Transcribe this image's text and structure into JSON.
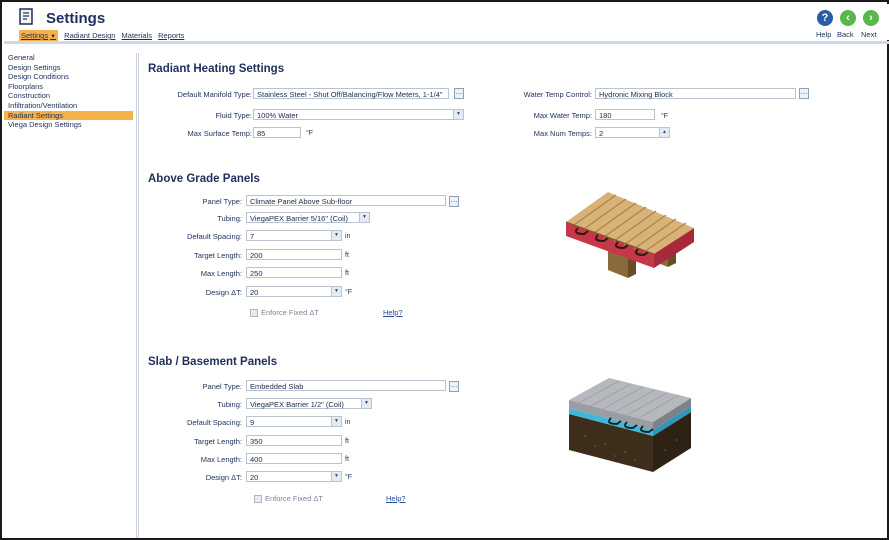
{
  "app": {
    "title": "Settings",
    "icon": "document-icon"
  },
  "nav": {
    "active": "Settings",
    "links": [
      "Radiant Design",
      "Materials",
      "Reports"
    ]
  },
  "top_buttons": [
    {
      "label": "Help",
      "icon": "question-icon"
    },
    {
      "label": "Back",
      "icon": "back-arrow-icon"
    },
    {
      "label": "Next",
      "icon": "next-arrow-icon"
    }
  ],
  "sidebar": {
    "items": [
      "General",
      "Design Settings",
      "Design Conditions",
      "Floorplans",
      "Construction",
      "Infiltration/Ventilation",
      "Radiant Settings",
      "Viega Design Settings"
    ],
    "selected": 6
  },
  "radiant": {
    "heading": "Radiant Heating Settings",
    "manifold_label": "Default Manifold Type:",
    "manifold_value": "Stainless Steel - Shut Off/Balancing/Flow Meters, 1-1/4\"",
    "fluid_label": "Fluid Type:",
    "fluid_value": "100% Water",
    "maxsurf_label": "Max Surface Temp:",
    "maxsurf_value": "85",
    "maxsurf_unit": "°F",
    "water_control_label": "Water Temp Control:",
    "water_control_value": "Hydronic Mixing Block",
    "maxwater_label": "Max Water Temp:",
    "maxwater_value": "180",
    "maxwater_unit": "°F",
    "maxnum_label": "Max Num Temps:",
    "maxnum_value": "2"
  },
  "above": {
    "heading": "Above Grade Panels",
    "panel_label": "Panel Type:",
    "panel_value": "Climate Panel Above Sub-floor",
    "tubing_label": "Tubing:",
    "tubing_value": "ViegaPEX Barrier 5/16\" (Coil)",
    "spacing_label": "Default Spacing:",
    "spacing_value": "7",
    "spacing_unit": "in",
    "target_label": "Target Length:",
    "target_value": "200",
    "target_unit": "ft",
    "max_label": "Max Length:",
    "max_value": "250",
    "max_unit": "ft",
    "dt_label": "Design ΔT:",
    "dt_value": "20",
    "dt_unit": "°F",
    "enforce_label": "Enforce Fixed ΔT",
    "help_link": "Help?"
  },
  "slab": {
    "heading": "Slab / Basement Panels",
    "panel_label": "Panel Type:",
    "panel_value": "Embedded Slab",
    "tubing_label": "Tubing:",
    "tubing_value": "ViegaPEX Barrier 1/2\" (Coil)",
    "spacing_label": "Default Spacing:",
    "spacing_value": "9",
    "spacing_unit": "in",
    "target_label": "Target Length:",
    "target_value": "350",
    "target_unit": "ft",
    "max_label": "Max Length:",
    "max_value": "400",
    "max_unit": "ft",
    "dt_label": "Design ΔT:",
    "dt_value": "20",
    "dt_unit": "°F",
    "enforce_label": "Enforce Fixed ΔT",
    "help_link": "Help?"
  },
  "colors": {
    "accent": "#f6b24a",
    "heading": "#1d2f5a",
    "link": "#2a4a9a",
    "help_button": "#2a5ca8",
    "nav_button": "#58b84a"
  }
}
